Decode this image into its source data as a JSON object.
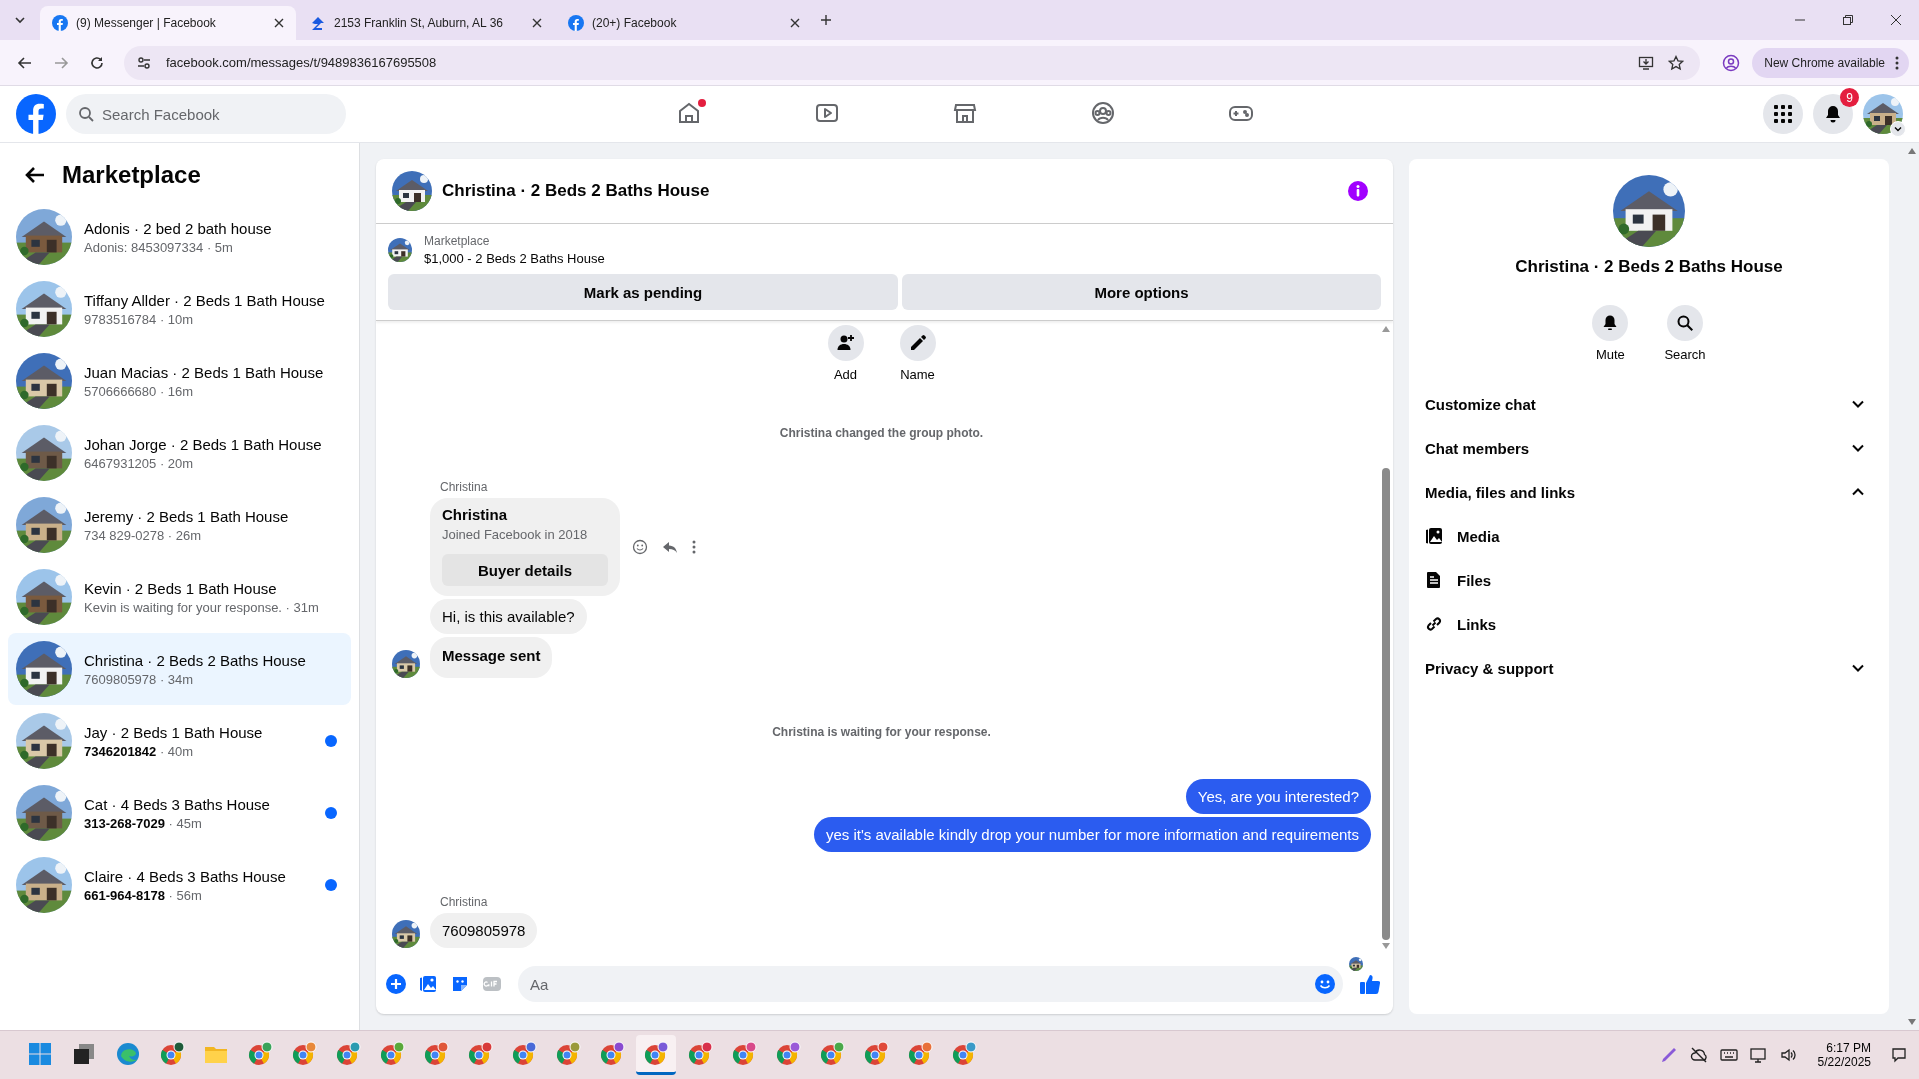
{
  "browser": {
    "tabs": [
      {
        "title": "(9) Messenger | Facebook",
        "kind": "facebook",
        "selected": true
      },
      {
        "title": "2153 Franklin St, Auburn, AL 36",
        "kind": "listing",
        "selected": false
      },
      {
        "title": "(20+) Facebook",
        "kind": "facebook",
        "selected": false
      }
    ],
    "url": "facebook.com/messages/t/9489836167695508",
    "update_button": "New Chrome available"
  },
  "header": {
    "search": {
      "placeholder": "Search Facebook"
    },
    "nav": [
      {
        "kind": "home",
        "selected": false,
        "alert": true
      },
      {
        "kind": "video",
        "selected": false,
        "alert": false
      },
      {
        "kind": "marketplace",
        "selected": false,
        "alert": false
      },
      {
        "kind": "groups",
        "selected": false,
        "alert": false
      },
      {
        "kind": "gaming",
        "selected": false,
        "alert": false
      }
    ],
    "notifications_badge": "9"
  },
  "sidebar": {
    "title": "Marketplace",
    "conversations": [
      {
        "title": "Adonis · 2 bed 2 bath house",
        "subtitle": "Adonis: 8453097334 · 5m",
        "selected": false,
        "unread": false
      },
      {
        "title": "Tiffany Allder · 2 Beds 1 Bath House",
        "subtitle": "9783516784 · 10m",
        "selected": false,
        "unread": false
      },
      {
        "title": "Juan Macias · 2 Beds 1 Bath House",
        "subtitle": "5706666680 · 16m",
        "selected": false,
        "unread": false
      },
      {
        "title": "Johan Jorge · 2 Beds 1 Bath House",
        "subtitle": "6467931205 · 20m",
        "selected": false,
        "unread": false
      },
      {
        "title": "Jeremy · 2 Beds 1 Bath House",
        "subtitle": "734 829-0278 · 26m",
        "selected": false,
        "unread": false
      },
      {
        "title": "Kevin · 2 Beds 1 Bath House",
        "subtitle": "Kevin is waiting for your response. · 31m",
        "selected": false,
        "unread": false
      },
      {
        "title": "Christina · 2 Beds 2 Baths House",
        "subtitle": "7609805978 · 34m",
        "selected": true,
        "unread": false
      },
      {
        "title": "Jay · 2 Beds 1 Bath House",
        "subtitle": "**7346201842** · 40m",
        "selected": false,
        "unread": true
      },
      {
        "title": "Cat · 4 Beds 3 Baths House",
        "subtitle": "**313-268-7029** · 45m",
        "selected": false,
        "unread": true
      },
      {
        "title": "Claire · 4 Beds 3 Baths House",
        "subtitle": "**661-964-8178** · 56m",
        "selected": false,
        "unread": true
      }
    ]
  },
  "chat": {
    "title": "Christina · 2 Beds 2 Baths House",
    "listing": {
      "label": "Marketplace",
      "text": "$1,000 - 2 Beds 2 Baths House"
    },
    "actions": [
      "Mark as pending",
      "More options"
    ],
    "group_actions": [
      {
        "kind": "add",
        "label": "Add"
      },
      {
        "kind": "rename",
        "label": "Name"
      }
    ],
    "messages": [
      {
        "kind": "system",
        "text": "Christina changed the group photo."
      },
      {
        "kind": "profile",
        "sender": "Christina",
        "name": "Christina",
        "detail": "Joined Facebook in 2018",
        "button": "Buyer details"
      },
      {
        "kind": "incoming",
        "text": "Hi, is this available?",
        "bold": false
      },
      {
        "kind": "incoming",
        "text": "Message sent",
        "bold": true
      },
      {
        "kind": "system",
        "text": "Christina is waiting for your response."
      },
      {
        "kind": "outgoing",
        "text": "Yes, are you interested?"
      },
      {
        "kind": "outgoing",
        "text": "yes it's available kindly drop your number for more information and requirements"
      },
      {
        "kind": "incoming",
        "sender": "Christina",
        "text": "7609805978",
        "bold": false
      }
    ],
    "composer": {
      "placeholder": "Aa"
    }
  },
  "details": {
    "title": "Christina · 2 Beds 2 Baths House",
    "actions": [
      {
        "kind": "mute",
        "label": "Mute"
      },
      {
        "kind": "search",
        "label": "Search"
      }
    ],
    "sections": [
      {
        "label": "Customize chat",
        "expanded": false
      },
      {
        "label": "Chat members",
        "expanded": false
      },
      {
        "label": "Media, files and links",
        "expanded": true,
        "children": [
          {
            "kind": "media",
            "label": "Media"
          },
          {
            "kind": "files",
            "label": "Files"
          },
          {
            "kind": "links",
            "label": "Links"
          }
        ]
      },
      {
        "label": "Privacy & support",
        "expanded": false
      }
    ]
  },
  "taskbar": {
    "apps": [
      {
        "kind": "start",
        "selected": false
      },
      {
        "kind": "terminal",
        "selected": false
      },
      {
        "kind": "edge",
        "selected": false
      },
      {
        "kind": "chrome",
        "color": "#1e5b3a",
        "selected": false
      },
      {
        "kind": "folder",
        "selected": false
      },
      {
        "kind": "chrome",
        "color": "#3aa35a",
        "selected": false
      },
      {
        "kind": "chrome",
        "color": "#e8883a",
        "selected": false
      },
      {
        "kind": "chrome",
        "color": "#2a9bb0",
        "selected": false
      },
      {
        "kind": "chrome",
        "color": "#5aa83a",
        "selected": false
      },
      {
        "kind": "chrome",
        "color": "#e0583a",
        "selected": false
      },
      {
        "kind": "chrome",
        "color": "#d83a3a",
        "selected": false
      },
      {
        "kind": "chrome",
        "color": "#4a6ad8",
        "selected": false
      },
      {
        "kind": "chrome",
        "color": "#9a9a3a",
        "selected": false
      },
      {
        "kind": "chrome",
        "color": "#8a4ad0",
        "selected": false
      },
      {
        "kind": "chrome",
        "color": "#7a5ad8",
        "selected": true
      },
      {
        "kind": "chrome",
        "color": "#d8304a",
        "selected": false
      },
      {
        "kind": "chrome",
        "color": "#d84a8a",
        "selected": false
      },
      {
        "kind": "chrome",
        "color": "#9a5ad8",
        "selected": false
      },
      {
        "kind": "chrome",
        "color": "#4aa84a",
        "selected": false
      },
      {
        "kind": "chrome",
        "color": "#e04a3a",
        "selected": false
      },
      {
        "kind": "chrome",
        "color": "#e8703a",
        "selected": false
      },
      {
        "kind": "chrome",
        "color": "#3a9ac8",
        "selected": false
      }
    ],
    "time": "6:17 PM",
    "date": "5/22/2025"
  }
}
